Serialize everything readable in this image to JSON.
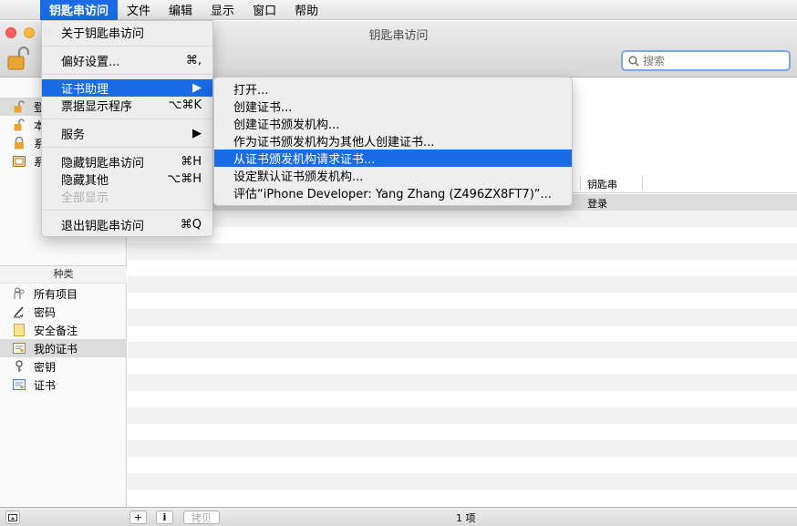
{
  "menubar": {
    "apple": "",
    "items": [
      "钥匙串访问",
      "文件",
      "编辑",
      "显示",
      "窗口",
      "帮助"
    ]
  },
  "window": {
    "title": "钥匙串访问",
    "search_placeholder": "搜索"
  },
  "keychains": [
    {
      "label": "登",
      "icon": "unlock-icon"
    },
    {
      "label": "本",
      "icon": "unlock-icon"
    },
    {
      "label": "系",
      "icon": "lock-icon"
    },
    {
      "label": "系",
      "icon": "cabinet-icon"
    }
  ],
  "category": {
    "header": "种类",
    "items": [
      {
        "label": "所有项目",
        "icon": "people-icon"
      },
      {
        "label": "密码",
        "icon": "pen-icon"
      },
      {
        "label": "安全备注",
        "icon": "note-icon"
      },
      {
        "label": "我的证书",
        "icon": "my-certificate-icon",
        "selected": true
      },
      {
        "label": "密钥",
        "icon": "key-icon"
      },
      {
        "label": "证书",
        "icon": "certificate-icon"
      }
    ]
  },
  "list": {
    "columns": [
      "钥匙串"
    ],
    "rows": [
      {
        "keychain": "登录"
      }
    ]
  },
  "app_menu": {
    "items": [
      {
        "label": "关于钥匙串访问",
        "shortcut": ""
      },
      {
        "label": "偏好设置...",
        "shortcut": "⌘,"
      },
      {
        "label": "证书助理",
        "shortcut": "▶",
        "highlighted": true
      },
      {
        "label": "票据显示程序",
        "shortcut": "⌥⌘K"
      },
      {
        "label": "服务",
        "shortcut": "▶"
      },
      {
        "label": "隐藏钥匙串访问",
        "shortcut": "⌘H"
      },
      {
        "label": "隐藏其他",
        "shortcut": "⌥⌘H"
      },
      {
        "label": "全部显示",
        "shortcut": "",
        "disabled": true
      },
      {
        "label": "退出钥匙串访问",
        "shortcut": "⌘Q"
      }
    ]
  },
  "cert_menu": {
    "items": [
      {
        "label": "打开..."
      },
      {
        "label": "创建证书..."
      },
      {
        "label": "创建证书颁发机构..."
      },
      {
        "label": "作为证书颁发机构为其他人创建证书..."
      },
      {
        "label": "从证书颁发机构请求证书...",
        "highlighted": true
      },
      {
        "label": "设定默认证书颁发机构..."
      },
      {
        "label": "评估“iPhone Developer: Yang Zhang (Z496ZX8FT7)”..."
      }
    ]
  },
  "bottom": {
    "add": "+",
    "info": "i",
    "copy": "拷贝",
    "count": "1 项"
  }
}
